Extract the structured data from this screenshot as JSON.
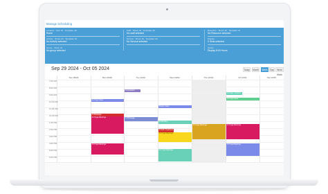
{
  "app": {
    "title": "Manage Scheduling"
  },
  "filters": {
    "location": {
      "label": "Location · Sort: ID · Template: All",
      "value": "Rome"
    },
    "activity": {
      "label": "Activity · Show: All · Template: All",
      "value": "No Activity selected"
    },
    "staff": {
      "label": "Staff · Show: All · Template: All",
      "value": "No staff selected"
    },
    "service": {
      "label": "Service · Show: All · Template: All",
      "value": "No Service selected"
    },
    "resource": {
      "label": "Resource · Show: All · Template: All",
      "value": "No Resource selected"
    },
    "group": {
      "label": "Group · Show: All",
      "value": "No group selected"
    },
    "display": {
      "label": "Display",
      "value": "0 Slots selected"
    },
    "option": {
      "label": "Option",
      "value": "Display 8:00 Hours"
    }
  },
  "toolbar": {
    "range": "Sep 29 2024 - Oct 05 2024",
    "prev": "‹",
    "next": "›",
    "buttons": [
      "Today",
      "Month",
      "Week",
      "Day",
      "Work Week"
    ],
    "active_view": "Week"
  },
  "days": [
    "Sun 09/29",
    "Mon 09/30",
    "Tue 10/01",
    "Wed 10/02",
    "Thu 10/03",
    "Fri 10/04",
    "Sat 10/05"
  ],
  "times": [
    "7:00 AM",
    "8:00 AM",
    "9:00 AM",
    "10:00 AM",
    "11:00 AM",
    "12:00 PM",
    "1:00 PM",
    "2:00 PM",
    "3:00 PM",
    "4:00 PM",
    "5:00 PM",
    "6:00 PM"
  ],
  "colors": {
    "accent": "#4a9fd6",
    "purple": "#8e7cc3",
    "magenta": "#d81b60",
    "red": "#d32f2f",
    "yellow": "#f9d71c",
    "gold": "#d9a520",
    "teal": "#68d1b8",
    "green": "#5fcf8f",
    "indigo": "#7b89e8",
    "steel": "#7c8dd6"
  },
  "events": [
    {
      "label": "Consultation",
      "color": "#8e7cc3",
      "text": "#ffffff"
    },
    {
      "label": "1h Yoga · Fitness",
      "color": "#68d1b8",
      "text": "#ffffff"
    },
    {
      "label": "1h Yoga Class",
      "color": "#5fcf8f",
      "text": "#ffffff"
    },
    {
      "label": "1h Yoga Class",
      "color": "#7b89e8",
      "text": "#ffffff"
    },
    {
      "label": "Pilates Class",
      "color": "#7b89e8",
      "text": "#ffffff"
    },
    {
      "label": "1h Massage",
      "color": "#d32f2f",
      "text": "#ffffff"
    },
    {
      "label": "1h Yoga Meetings",
      "color": "#d81b60",
      "text": "#ffffff"
    },
    {
      "label": "1h Massage",
      "color": "#7c8dd6",
      "text": "#ffffff"
    },
    {
      "label": "1h Meeting",
      "color": "#68d1b8",
      "text": "#ffffff"
    },
    {
      "label": "1h Hair Treatment",
      "color": "#d32f2f",
      "text": "#ffffff"
    },
    {
      "label": "1h Yoga Meetings",
      "color": "#f9d71c",
      "text": "#7a5a00"
    },
    {
      "label": "1h Yoga Meetings",
      "color": "#d9a520",
      "text": "#ffffff"
    },
    {
      "label": "1h Yoga Meetings",
      "color": "#d81b60",
      "text": "#ffffff"
    },
    {
      "label": "1h Yoga Meetings",
      "color": "#d81b60",
      "text": "#ffffff"
    },
    {
      "label": "1h Yoga Meetings",
      "color": "#68d1b8",
      "text": "#ffffff"
    },
    {
      "label": "1h Yoga Meetings",
      "color": "#7b89e8",
      "text": "#ffffff"
    }
  ]
}
